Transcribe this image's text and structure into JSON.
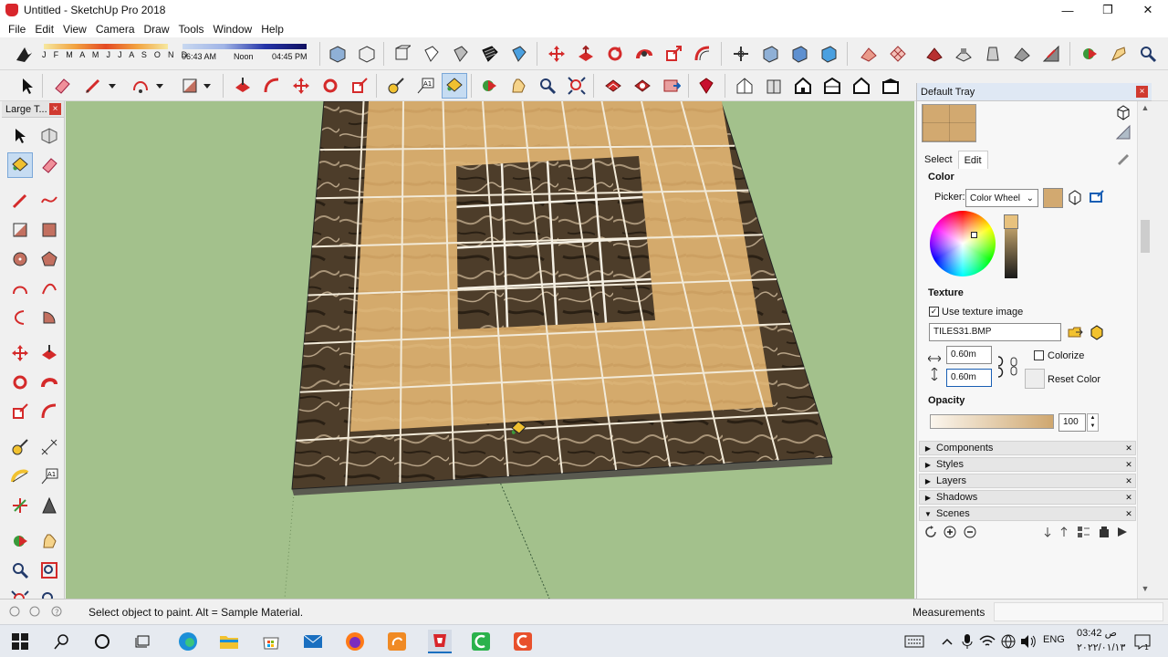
{
  "window": {
    "title": "Untitled - SketchUp Pro 2018",
    "minimize": "—",
    "maximize": "❐",
    "close": "✕"
  },
  "menu": [
    "File",
    "Edit",
    "View",
    "Camera",
    "Draw",
    "Tools",
    "Window",
    "Help"
  ],
  "shadow_widget": {
    "months": "J F M A M J J A S O N D",
    "time_start": "06:43 AM",
    "time_mid": "Noon",
    "time_end": "04:45 PM"
  },
  "large_tools": {
    "title": "Large T...",
    "close": "×"
  },
  "tray": {
    "title": "Default Tray",
    "close": "×",
    "tabs": [
      "Select",
      "Edit"
    ],
    "color": {
      "label": "Color",
      "picker_label": "Picker:",
      "picker_value": "Color Wheel",
      "swatch_color": "#d2a970"
    },
    "texture": {
      "label": "Texture",
      "use_texture_label": "Use texture image",
      "use_texture_checked": true,
      "file": "TILES31.BMP",
      "width": "0.60m",
      "height": "0.60m",
      "colorize_label": "Colorize",
      "reset_label": "Reset Color"
    },
    "opacity": {
      "label": "Opacity",
      "value": "100"
    },
    "panels": [
      {
        "arrow": "▶",
        "name": "Components"
      },
      {
        "arrow": "▶",
        "name": "Styles"
      },
      {
        "arrow": "▶",
        "name": "Layers"
      },
      {
        "arrow": "▶",
        "name": "Shadows"
      },
      {
        "arrow": "▼",
        "name": "Scenes"
      }
    ]
  },
  "status": {
    "text": "Select object to paint. Alt = Sample Material.",
    "measurements_label": "Measurements",
    "measurements_value": ""
  },
  "taskbar": {
    "time": "03:42 ص",
    "date": "٢٠٢٢/٠١/١٣",
    "lang": "ENG",
    "notifications": "1"
  },
  "colors": {
    "viewport_bg": "#a3c18c",
    "beige_tile": "#d2a970",
    "marble_tile": "#4a3a28"
  }
}
